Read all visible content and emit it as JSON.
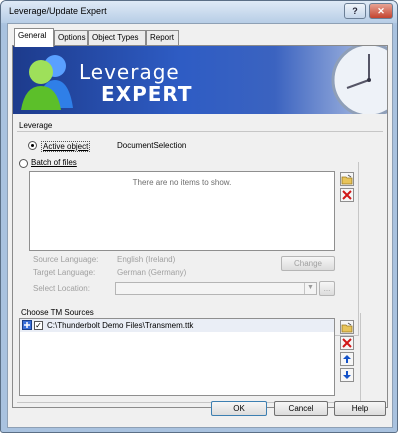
{
  "window": {
    "title": "Leverage/Update Expert"
  },
  "tabs": [
    {
      "label": "General"
    },
    {
      "label": "Options"
    },
    {
      "label": "Object Types"
    },
    {
      "label": "Report"
    }
  ],
  "banner": {
    "line1": "Leverage",
    "line2": "EXPERT"
  },
  "leverage": {
    "group_label": "Leverage",
    "active_object_label": "Active object",
    "active_object_value": "DocumentSelection",
    "batch_label": "Batch of files",
    "empty_text": "There are no items to show.",
    "source_language_label": "Source Language:",
    "source_language_value": "English (Ireland)",
    "target_language_label": "Target Language:",
    "target_language_value": "German (Germany)",
    "change_button": "Change",
    "select_location_label": "Select Location:",
    "browse_button": "..."
  },
  "tm_sources": {
    "group_label": "Choose TM Sources",
    "items": [
      {
        "path": "C:\\Thunderbolt Demo Files\\Transmem.ttk",
        "checked": true
      }
    ]
  },
  "footer": {
    "ok": "OK",
    "cancel": "Cancel",
    "help": "Help"
  },
  "colors": {
    "banner_dark": "#1d3b8c",
    "banner_light": "#3b63c0",
    "remove_red": "#d01818",
    "arrow_blue": "#1452c8"
  }
}
